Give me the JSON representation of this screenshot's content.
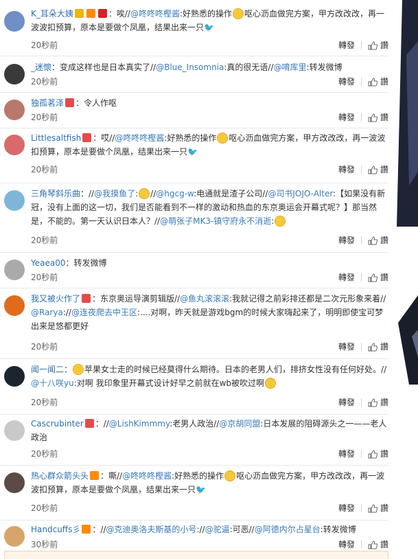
{
  "actions": {
    "repost": "轉發",
    "like": "讚"
  },
  "comments": [
    {
      "user": "K_耳朵大姨",
      "segments": [
        {
          "t": "：唉//",
          "c": "text"
        },
        {
          "t": "@咚咚咚樫酱",
          "c": "mention"
        },
        {
          "t": ":好熟悉的操作",
          "c": "text"
        },
        {
          "t": "",
          "c": "emoji"
        },
        {
          "t": "呕心沥血做完方案，甲方改改改，再一波波扣预算，原本是要做个凤凰，结果出来一只",
          "c": "text"
        },
        {
          "t": "🐦",
          "c": "text"
        }
      ],
      "time": "20秒前"
    },
    {
      "user": "_迷懷",
      "segments": [
        {
          "t": "：变成这样也是日本真实了//",
          "c": "text"
        },
        {
          "t": "@Blue_Insomnia",
          "c": "mention"
        },
        {
          "t": ":真的很无语//",
          "c": "text"
        },
        {
          "t": "@唷库里",
          "c": "mention"
        },
        {
          "t": ":转发微博",
          "c": "text"
        }
      ],
      "time": "20秒前"
    },
    {
      "user": "独孤茗泽",
      "segments": [
        {
          "t": "：令人作呕",
          "c": "text"
        }
      ],
      "time": "20秒前"
    },
    {
      "user": "Littlesaltfish",
      "segments": [
        {
          "t": "：哎//",
          "c": "text"
        },
        {
          "t": "@咚咚咚樫酱",
          "c": "mention"
        },
        {
          "t": ":好熟悉的操作",
          "c": "text"
        },
        {
          "t": "",
          "c": "emoji"
        },
        {
          "t": "呕心沥血做完方案，甲方改改改，再一波波扣预算，原本是要做个凤凰，结果出来一只",
          "c": "text"
        },
        {
          "t": "🐦",
          "c": "text"
        }
      ],
      "time": "20秒前"
    },
    {
      "user": "三角琴斜乐曲",
      "segments": [
        {
          "t": "：//",
          "c": "text"
        },
        {
          "t": "@我摸鱼了",
          "c": "mention"
        },
        {
          "t": ":",
          "c": "text"
        },
        {
          "t": "",
          "c": "emoji"
        },
        {
          "t": "//",
          "c": "text"
        },
        {
          "t": "@hgcg-w",
          "c": "mention"
        },
        {
          "t": ":电通就是渣子公司//",
          "c": "text"
        },
        {
          "t": "@司书JOJO-Alter",
          "c": "mention"
        },
        {
          "t": ":【如果没有新冠，没有上面的这一切，我们是否能看到不一样的激动和热血的东京奥运会开幕式呢？】那当然是，不能的。第一天认识日本人？//",
          "c": "text"
        },
        {
          "t": "@萌张子MK3-镇守府永不消逝",
          "c": "mention"
        },
        {
          "t": ":",
          "c": "text"
        },
        {
          "t": "",
          "c": "emoji"
        }
      ],
      "time": "20秒前"
    },
    {
      "user": "Yeaea00",
      "segments": [
        {
          "t": "：转发微博",
          "c": "text"
        }
      ],
      "time": "20秒前"
    },
    {
      "user": "我又被火作了",
      "segments": [
        {
          "t": "：东京奥运导演剪辑版//",
          "c": "text"
        },
        {
          "t": "@鱼丸滚滚滚",
          "c": "mention"
        },
        {
          "t": ":我就记得之前彩排还都是二次元形象来着//",
          "c": "text"
        },
        {
          "t": "@Rarya",
          "c": "mention"
        },
        {
          "t": "://",
          "c": "text"
        },
        {
          "t": "@连夜爬去中王区",
          "c": "mention"
        },
        {
          "t": ":....对啊，昨天就是游戏bgm的时候大家嗨起来了，明明即使宝可梦出来是悠都更好",
          "c": "text"
        }
      ],
      "time": "20秒前"
    },
    {
      "user": "闻一闻二",
      "segments": [
        {
          "t": "：",
          "c": "text"
        },
        {
          "t": "",
          "c": "emoji"
        },
        {
          "t": "苹果女士走的时候已经莫得什么期待。日本的老男人们，排挤女性没有任何好处。//",
          "c": "text"
        },
        {
          "t": "@十八咲yu",
          "c": "mention"
        },
        {
          "t": ":对啊 我印象里开幕式设计好早之前就在wb被吹过啊",
          "c": "text"
        },
        {
          "t": "",
          "c": "emoji"
        }
      ],
      "time": "20秒前"
    },
    {
      "user": "Cascrubinter",
      "segments": [
        {
          "t": "：//",
          "c": "text"
        },
        {
          "t": "@LishKimmmy",
          "c": "mention"
        },
        {
          "t": ":老男人政治//",
          "c": "text"
        },
        {
          "t": "@京胡同盟",
          "c": "mention"
        },
        {
          "t": ":日本发展的阻碍源头之一——老人政治",
          "c": "text"
        }
      ],
      "time": "20秒前"
    },
    {
      "user": "热心群众箭头头",
      "segments": [
        {
          "t": "：嘶//",
          "c": "text"
        },
        {
          "t": "@咚咚咚樫酱",
          "c": "mention"
        },
        {
          "t": ":好熟悉的操作",
          "c": "text"
        },
        {
          "t": "",
          "c": "emoji"
        },
        {
          "t": "呕心沥血做完方案，甲方改改改，再一波波扣预算，原本是要做个凤凰，结果出来一只",
          "c": "text"
        },
        {
          "t": "🐦",
          "c": "text"
        }
      ],
      "time": "20秒前"
    },
    {
      "user": "Handcuffs彡",
      "segments": [
        {
          "t": "：//",
          "c": "text"
        },
        {
          "t": "@克迪奥洛夫斯基的小号",
          "c": "mention"
        },
        {
          "t": "://",
          "c": "text"
        },
        {
          "t": "@驼逼",
          "c": "mention"
        },
        {
          "t": ":可恶//",
          "c": "text"
        },
        {
          "t": "@阿德内尔占星台",
          "c": "mention"
        },
        {
          "t": ":转发微博",
          "c": "text"
        }
      ],
      "time": "30秒前"
    }
  ]
}
